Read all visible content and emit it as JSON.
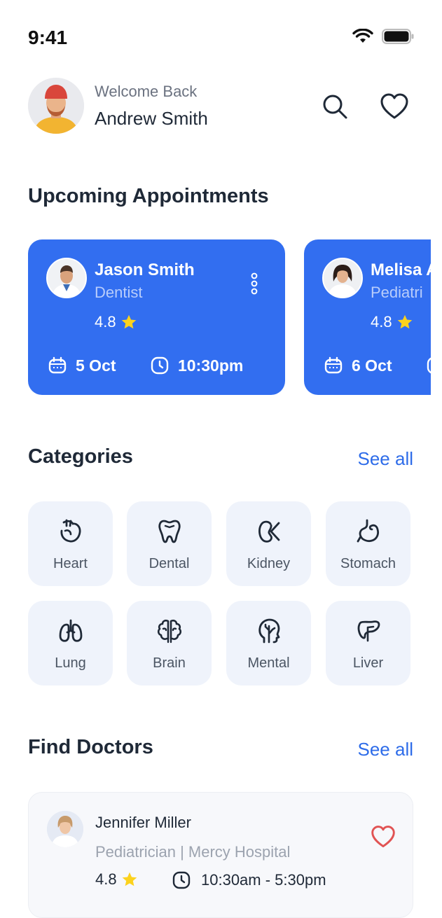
{
  "status_bar": {
    "time": "9:41"
  },
  "header": {
    "welcome": "Welcome Back",
    "user_name": "Andrew Smith"
  },
  "appointments": {
    "title": "Upcoming Appointments",
    "items": [
      {
        "doctor": "Jason Smith",
        "specialty": "Dentist",
        "rating": "4.8",
        "date": "5 Oct",
        "time": "10:30pm"
      },
      {
        "doctor": "Melisa A",
        "specialty": "Pediatri",
        "rating": "4.8",
        "date": "6 Oct",
        "time": ""
      }
    ]
  },
  "categories": {
    "title": "Categories",
    "see_all": "See all",
    "items": [
      {
        "label": "Heart",
        "icon": "heart-organ-icon"
      },
      {
        "label": "Dental",
        "icon": "tooth-icon"
      },
      {
        "label": "Kidney",
        "icon": "kidney-icon"
      },
      {
        "label": "Stomach",
        "icon": "stomach-icon"
      },
      {
        "label": "Lung",
        "icon": "lungs-icon"
      },
      {
        "label": "Brain",
        "icon": "brain-icon"
      },
      {
        "label": "Mental",
        "icon": "mental-head-icon"
      },
      {
        "label": "Liver",
        "icon": "liver-icon"
      }
    ]
  },
  "find_doctors": {
    "title": "Find Doctors",
    "see_all": "See all",
    "doctor": {
      "name": "Jennifer Miller",
      "subtitle": "Pediatrician | Mercy Hospital",
      "rating": "4.8",
      "hours": "10:30am - 5:30pm"
    }
  },
  "colors": {
    "primary": "#326ef0",
    "accent_link": "#2e6ce9",
    "star": "#fcd21d",
    "heart": "#e15353",
    "tile_bg": "#eff3fb"
  }
}
